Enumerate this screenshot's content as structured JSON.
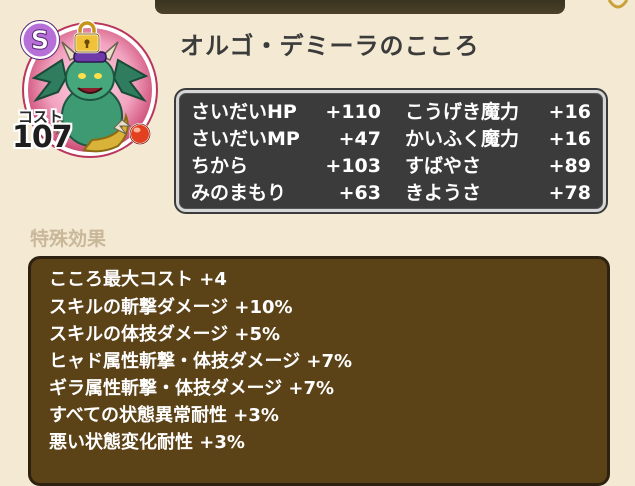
{
  "heart": {
    "rank": "S",
    "name": "オルゴ・デミーラのこころ",
    "cost_label": "コスト",
    "cost_value": "107"
  },
  "stats": [
    {
      "name": "さいだいHP",
      "value": "+110"
    },
    {
      "name": "こうげき魔力",
      "value": "+16"
    },
    {
      "name": "さいだいMP",
      "value": "+47"
    },
    {
      "name": "かいふく魔力",
      "value": "+16"
    },
    {
      "name": "ちから",
      "value": "+103"
    },
    {
      "name": "すばやさ",
      "value": "+89"
    },
    {
      "name": "みのまもり",
      "value": "+63"
    },
    {
      "name": "きようさ",
      "value": "+78"
    }
  ],
  "effects": {
    "title": "特殊効果",
    "lines": [
      "こころ最大コスト +4",
      "スキルの斬撃ダメージ +10%",
      "スキルの体技ダメージ +5%",
      "ヒャド属性斬撃・体技ダメージ +7%",
      "ギラ属性斬撃・体技ダメージ +7%",
      "すべての状態異常耐性 +3%",
      "悪い状態変化耐性 +3%"
    ]
  },
  "colors": {
    "background": "#f4ead3",
    "stats_panel": "#3b3b3b",
    "effects_panel": "#5c4217",
    "rank_badge": "#b56fd6"
  },
  "icons": {
    "rank": "rank-s-badge-icon",
    "lock": "padlock-icon",
    "orb": "red-orb-icon"
  }
}
